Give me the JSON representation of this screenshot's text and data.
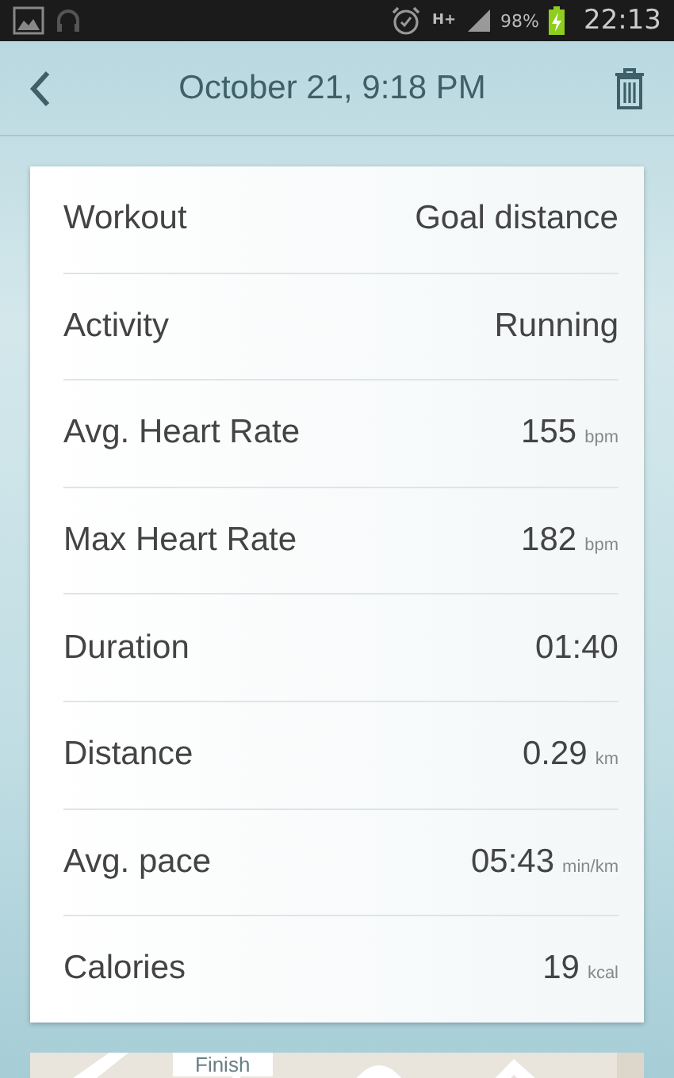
{
  "status_bar": {
    "battery": "98%",
    "time": "22:13",
    "network": "H+"
  },
  "header": {
    "title": "October 21, 9:18 PM"
  },
  "details": [
    {
      "label": "Workout",
      "value": "Goal distance"
    },
    {
      "label": "Activity",
      "value": "Running"
    },
    {
      "label": "Avg. Heart Rate",
      "value": "155",
      "unit": "bpm"
    },
    {
      "label": "Max Heart Rate",
      "value": "182",
      "unit": "bpm"
    },
    {
      "label": "Duration",
      "value": "01:40"
    },
    {
      "label": "Distance",
      "value": "0.29",
      "unit": "km"
    },
    {
      "label": "Avg. pace",
      "value": "05:43",
      "unit": "min/km"
    },
    {
      "label": "Calories",
      "value": "19",
      "unit": "kcal"
    }
  ],
  "map": {
    "marker_label": "Finish"
  }
}
